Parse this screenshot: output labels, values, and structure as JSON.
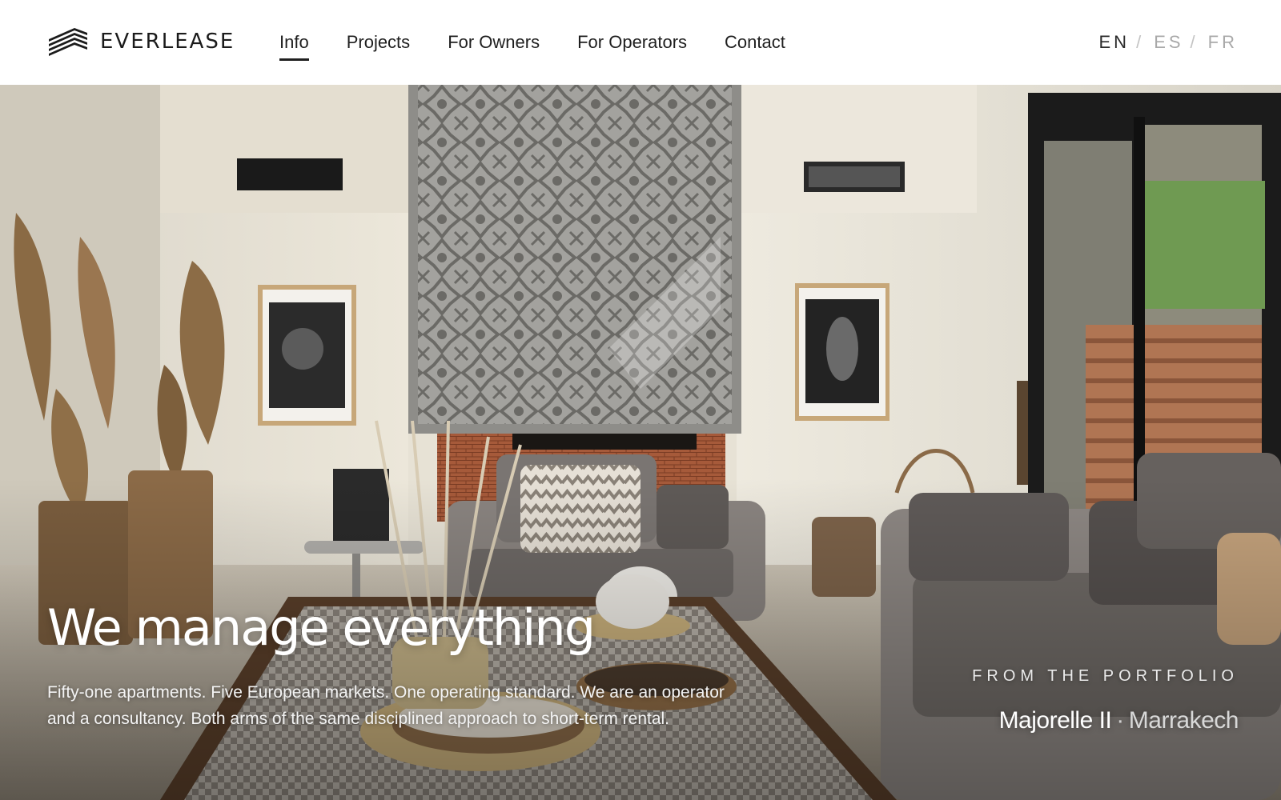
{
  "brand": {
    "name": "EVERLEASE",
    "logo_icon": "stacked-lines-logo-icon"
  },
  "nav": {
    "items": [
      {
        "label": "Info",
        "active": true
      },
      {
        "label": "Projects",
        "active": false
      },
      {
        "label": "For Owners",
        "active": false
      },
      {
        "label": "For Operators",
        "active": false
      },
      {
        "label": "Contact",
        "active": false
      }
    ]
  },
  "languages": {
    "items": [
      {
        "label": "EN",
        "active": true
      },
      {
        "label": "ES",
        "active": false
      },
      {
        "label": "FR",
        "active": false
      }
    ],
    "separator": "/"
  },
  "hero": {
    "image_description": "living room interior",
    "headline": "We manage everything",
    "subtext": "Fifty-one apartments. Five European markets. One operating standard. We are an operator and a consultancy. Both arms of the same disciplined approach to short-term rental.",
    "portfolio_label": "FROM THE PORTFOLIO",
    "portfolio_name": "Majorelle II",
    "portfolio_separator": "·",
    "portfolio_city": "Marrakech"
  },
  "colors": {
    "text_dark": "#1f1f1f",
    "inactive_lang": "#a9a9a9",
    "header_bg": "#ffffff",
    "hero_text": "#ffffff"
  }
}
